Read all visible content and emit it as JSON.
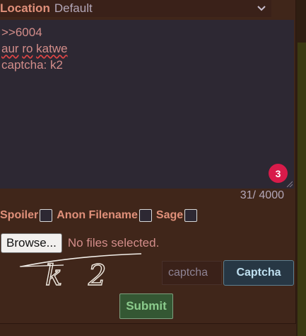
{
  "location": {
    "label": "Location",
    "value": "Default"
  },
  "post": {
    "lines": [
      ">>6004",
      "aur ro katwe",
      "captcha: k2"
    ],
    "spell_words": [
      "aur",
      "ro",
      "katwe"
    ]
  },
  "badge": {
    "count": "3"
  },
  "char_count": "31/ 4000",
  "options": {
    "spoiler": "Spoiler",
    "anon_filename": "Anon Filename",
    "sage": "Sage"
  },
  "file": {
    "browse_label": "Browse...",
    "status": "No files selected."
  },
  "captcha": {
    "image_text": "k 2",
    "input_placeholder": "captcha",
    "button_label": "Captcha"
  },
  "submit_label": "Submit",
  "colors": {
    "label_accent": "#e0907a",
    "text_pink": "#d38d8a",
    "badge": "#d81b4a",
    "submit_green": "#345733"
  }
}
